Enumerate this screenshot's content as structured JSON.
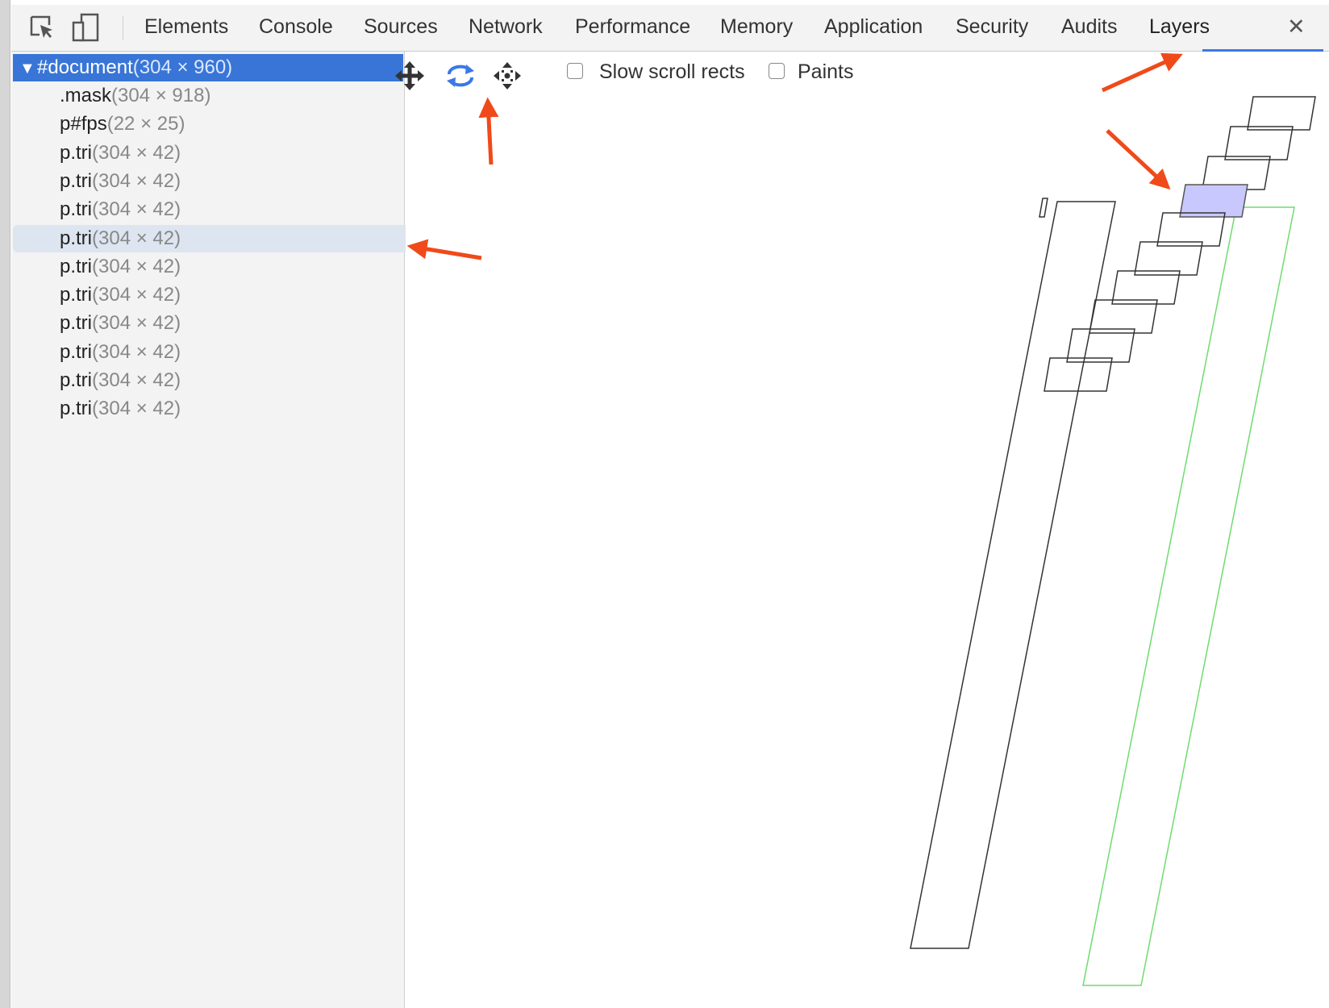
{
  "toolbar": {
    "tabs": [
      {
        "label": "Elements"
      },
      {
        "label": "Console"
      },
      {
        "label": "Sources"
      },
      {
        "label": "Network"
      },
      {
        "label": "Performance"
      },
      {
        "label": "Memory"
      },
      {
        "label": "Application"
      },
      {
        "label": "Security"
      },
      {
        "label": "Audits"
      },
      {
        "label": "Layers"
      }
    ],
    "active_tab": "Layers",
    "close_glyph": "✕",
    "accent_color": "#3b78e7"
  },
  "layer_tree": {
    "root": {
      "name": "#document",
      "size": "(304 × 960)"
    },
    "children": [
      {
        "name": ".mask",
        "size": "(304 × 918)"
      },
      {
        "name": "p#fps",
        "size": "(22 × 25)"
      },
      {
        "name": "p.tri",
        "size": "(304 × 42)"
      },
      {
        "name": "p.tri",
        "size": "(304 × 42)"
      },
      {
        "name": "p.tri",
        "size": "(304 × 42)"
      },
      {
        "name": "p.tri",
        "size": "(304 × 42)"
      },
      {
        "name": "p.tri",
        "size": "(304 × 42)"
      },
      {
        "name": "p.tri",
        "size": "(304 × 42)"
      },
      {
        "name": "p.tri",
        "size": "(304 × 42)"
      },
      {
        "name": "p.tri",
        "size": "(304 × 42)"
      },
      {
        "name": "p.tri",
        "size": "(304 × 42)"
      },
      {
        "name": "p.tri",
        "size": "(304 × 42)"
      }
    ],
    "selected_color": "#3875d7"
  },
  "viewer": {
    "tool_icons": [
      "pan-icon",
      "rotate-icon",
      "reset-view-icon"
    ],
    "checkboxes": [
      {
        "label": "Slow scroll rects",
        "checked": false
      },
      {
        "label": "Paints",
        "checked": false
      }
    ],
    "highlight_color": "#c8c8ff",
    "outline_colors": {
      "default": "#333333",
      "mask": "#6fdc6f"
    }
  },
  "annotation_color": "#f04a1a"
}
